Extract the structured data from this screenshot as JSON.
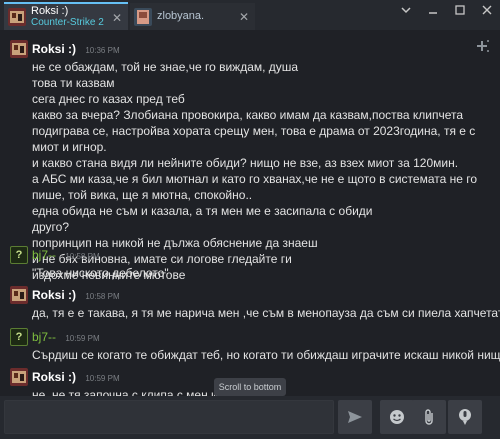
{
  "tabs": [
    {
      "name": "Roksi :)",
      "status": "Counter-Strike 2",
      "close": "✕"
    },
    {
      "name": "zlobyana.",
      "close": "✕"
    }
  ],
  "messages": [
    {
      "author": "Roksi :)",
      "time": "10:36 PM",
      "lines": [
        "не се обаждам, той не знае,че го виждам, душа",
        "това ти казвам",
        "сега днес го казах пред теб",
        "какво за вчера? Злобиана провокира, какво имам да казвам,поства клипчета подиграва се, настройва хората срещу мен, това е драма от 2023година, тя е с миот и игнор.",
        "и какво стана видя ли нейните обиди? нищо не взе, аз взех миот за 120мин.",
        "а АБС ми каза,че я бил мютнал и като го хванах,че не е щото в системата не го пише, той вика, ще я мютна, спокойно..",
        "една обида не съм и казала, а тя мен ме е засипала с обиди",
        "друго?",
        "попринцип на никой не дължа обяснение да знаеш",
        "и не бях виновна, имате си логове гледайте ги",
        "издохме невинните мютове"
      ]
    },
    {
      "author": "bj7--",
      "time": "10:58 PM",
      "lines": [
        "\"Това нискoто дебелото\""
      ]
    },
    {
      "author": "Roksi :)",
      "time": "10:58 PM",
      "lines": [
        "да, тя е е такава, я тя ме нарича мен ,че съм в менопауза да съм си пиела хапчетата"
      ]
    },
    {
      "author": "bj7--",
      "time": "10:59 PM",
      "lines": [
        "Сърдиш се когато те обиждат теб, но когато ти обиждаш играчите искаш никой нищо да не ти прави"
      ]
    },
    {
      "author": "Roksi :)",
      "time": "10:59 PM",
      "lines": [
        "не, не тя започна с клипа с мен и жоркат"
      ]
    }
  ],
  "scroll_to_bottom": "Scroll to bottom",
  "bj_avatar_glyph": "?",
  "colors": {
    "accent": "#66c0f4",
    "status": "#57cbde",
    "bj_name": "#7fbf3f"
  }
}
